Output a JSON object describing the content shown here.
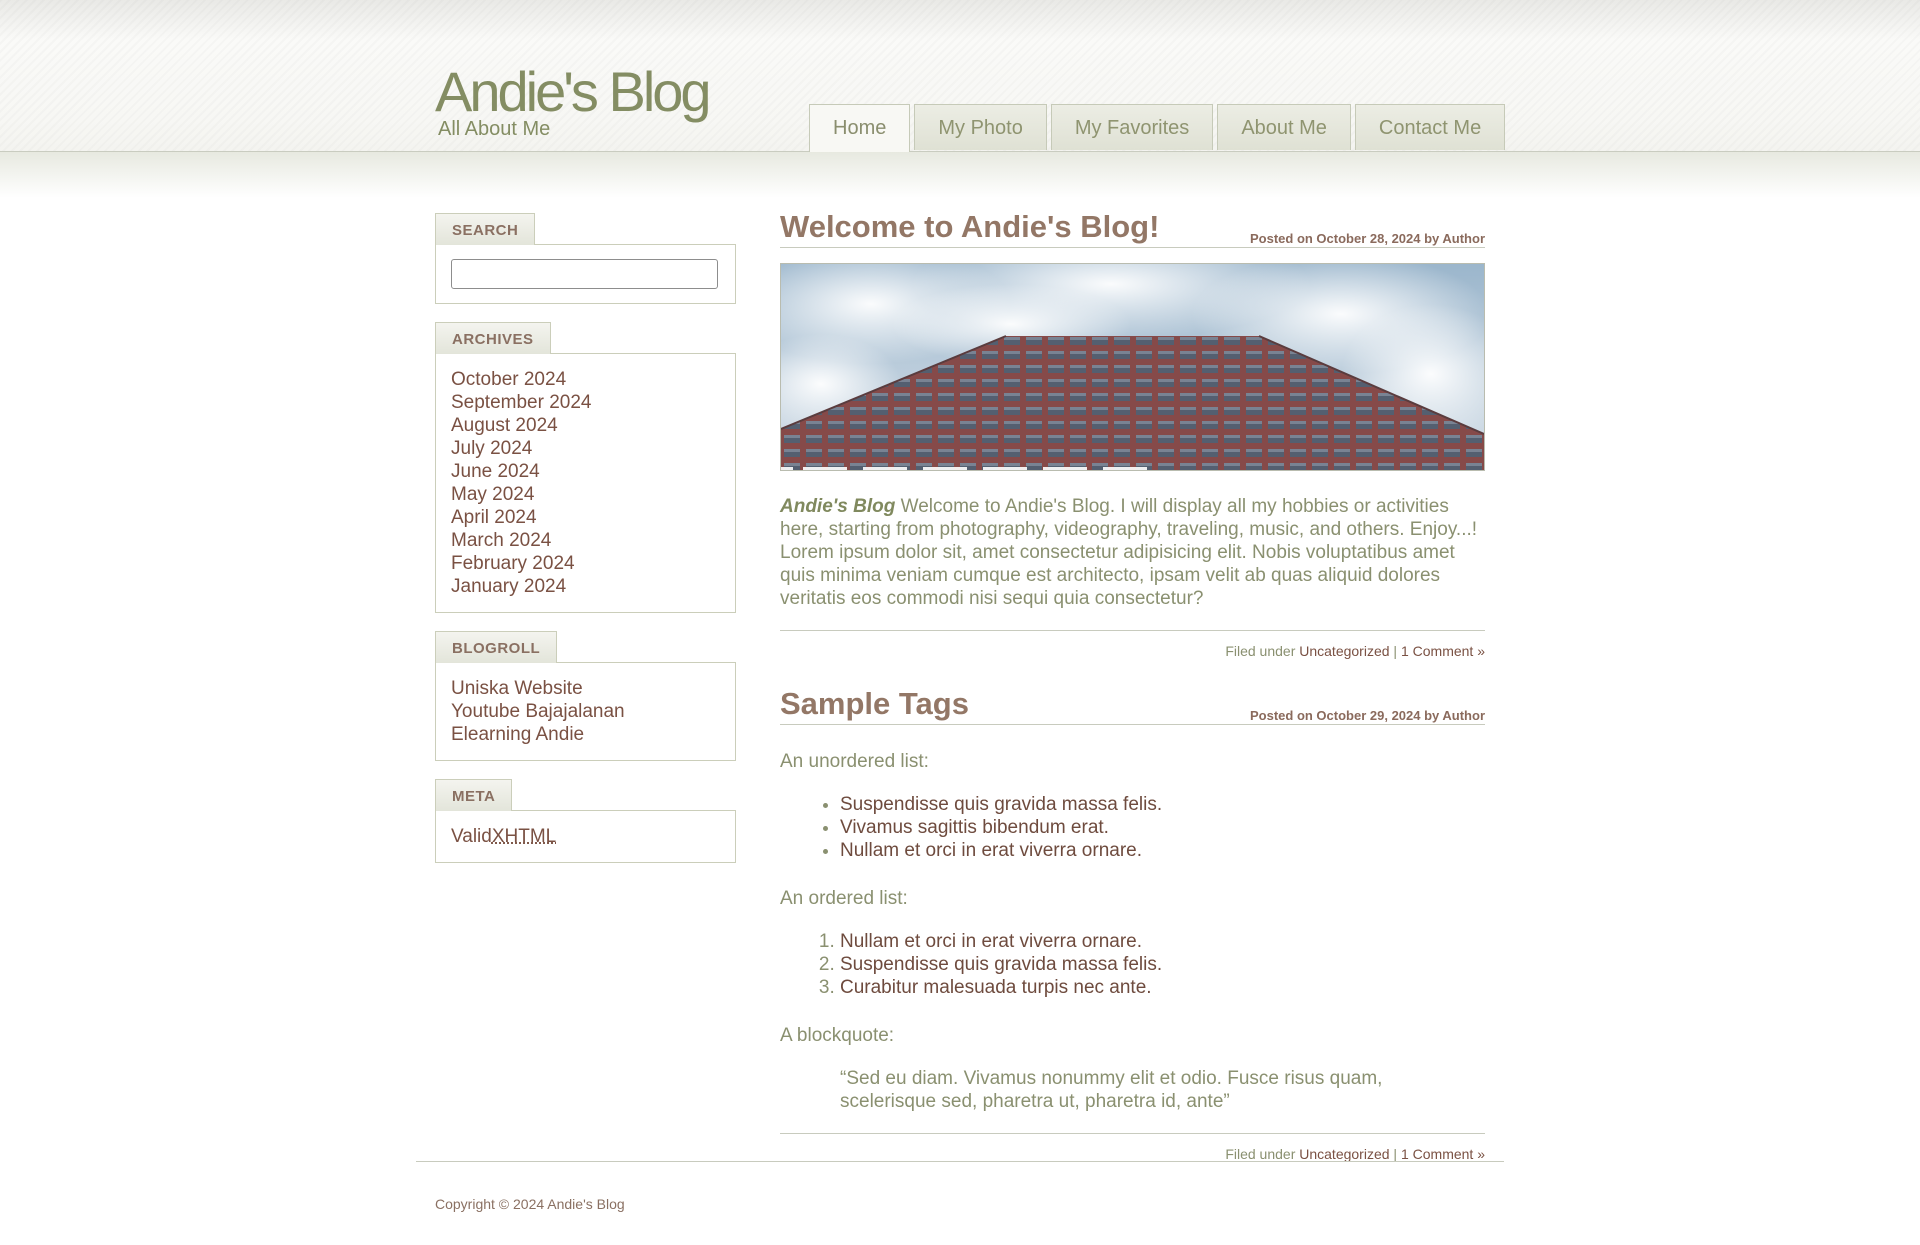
{
  "site": {
    "title": "Andie's Blog",
    "tagline": "All About Me"
  },
  "nav": {
    "items": [
      {
        "label": "Home"
      },
      {
        "label": "My Photo"
      },
      {
        "label": "My Favorites"
      },
      {
        "label": "About Me"
      },
      {
        "label": "Contact Me"
      }
    ]
  },
  "sidebar": {
    "search": {
      "heading": "SEARCH",
      "value": "",
      "placeholder": ""
    },
    "archives": {
      "heading": "ARCHIVES",
      "items": [
        "October 2024",
        "September 2024",
        "August 2024",
        "July 2024",
        "June 2024",
        "May 2024",
        "April 2024",
        "March 2024",
        "February 2024",
        "January 2024"
      ]
    },
    "blogroll": {
      "heading": "BLOGROLL",
      "items": [
        "Uniska Website",
        "Youtube Bajajalanan",
        "Elearning Andie"
      ]
    },
    "meta": {
      "heading": "META",
      "valid": "Valid",
      "xhtml": "XHTML"
    }
  },
  "posts": [
    {
      "title": "Welcome to Andie's Blog!",
      "meta": "Posted on October 28, 2024 by Author",
      "lead": "Andie's Blog",
      "body": " Welcome to Andie's Blog. I will display all my hobbies or activities here, starting from photography, videography, traveling, music, and others. Enjoy...! Lorem ipsum dolor sit, amet consectetur adipisicing elit. Nobis voluptatibus amet quis minima veniam cumque est architecto, ipsam velit ab quas aliquid dolores veritatis eos commodi nisi sequi quia consectetur?",
      "filed": "Filed under ",
      "category": "Uncategorized",
      "sep": " | ",
      "comments": "1 Comment »"
    },
    {
      "title": "Sample Tags",
      "meta": "Posted on October 29, 2024 by Author",
      "ul_label": "An unordered list:",
      "ul": [
        "Suspendisse quis gravida massa felis.",
        "Vivamus sagittis bibendum erat.",
        "Nullam et orci in erat viverra ornare."
      ],
      "ol_label": "An ordered list:",
      "ol": [
        "Nullam et orci in erat viverra ornare.",
        "Suspendisse quis gravida massa felis.",
        "Curabitur malesuada turpis nec ante."
      ],
      "quote_label": "A blockquote:",
      "quote": "“Sed eu diam. Vivamus nonummy elit et odio. Fusce risus quam, scelerisque sed, pharetra ut, pharetra id, ante”",
      "filed": "Filed under ",
      "category": "Uncategorized",
      "sep": " | ",
      "comments": "1 Comment »"
    }
  ],
  "footer": {
    "copyright": "Copyright © 2024 Andie's Blog"
  },
  "colors": {
    "accent": "#848d63",
    "title": "#937766",
    "link": "#7a5143",
    "border": "#c8cbbe"
  }
}
